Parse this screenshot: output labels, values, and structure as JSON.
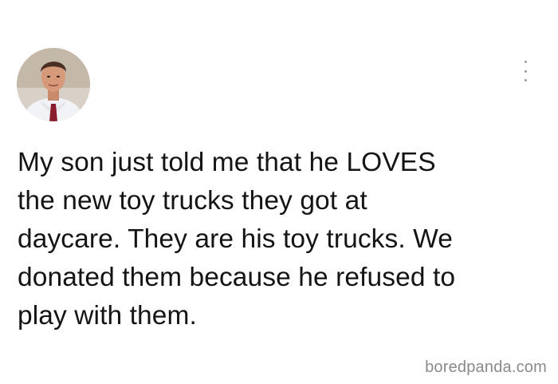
{
  "post": {
    "avatar": {
      "icon": "profile-photo-icon"
    },
    "menu": {
      "icon": "more-vertical-icon"
    },
    "text": "My son just told me that he LOVES\nthe new toy trucks they got at\ndaycare. They are his toy trucks. We\ndonated them because he refused to\nplay with them."
  },
  "watermark": "boredpanda.com",
  "colors": {
    "background": "#ffffff",
    "text": "#141414",
    "watermark": "#8a8a8a",
    "menu_dots": "#9b9b9b"
  }
}
